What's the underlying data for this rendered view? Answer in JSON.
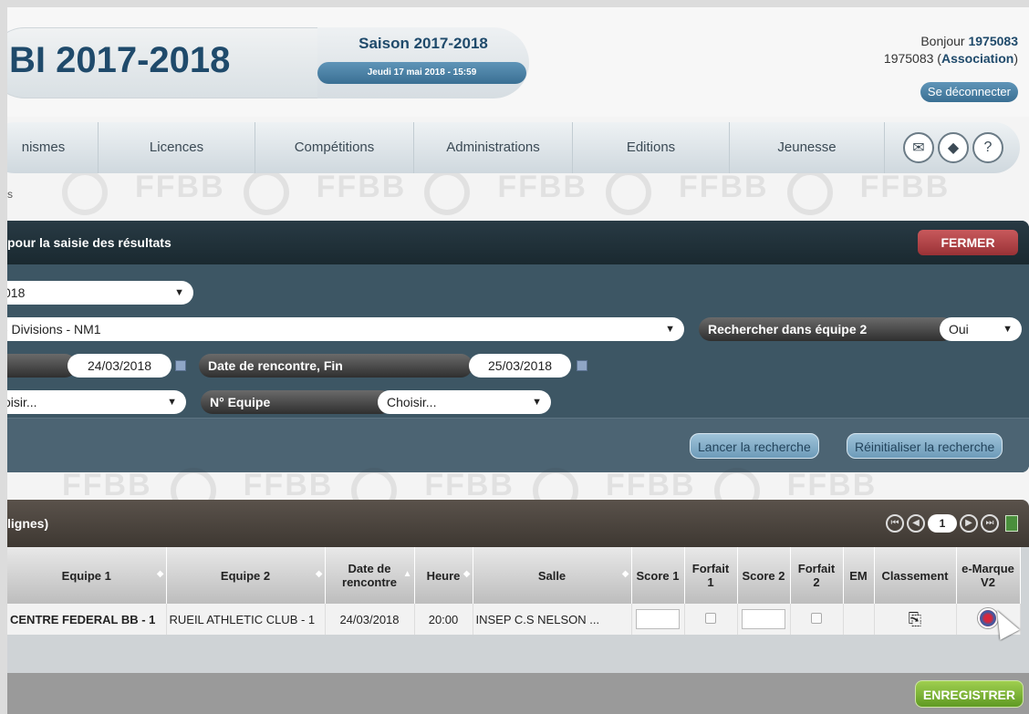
{
  "header": {
    "app_title": "BI 2017-2018",
    "season": "Saison 2017-2018",
    "datetime": "Jeudi 17 mai 2018 - 15:59",
    "greeting_prefix": "Bonjour ",
    "greeting_user": "1975083",
    "account_line_prefix": "1975083 (",
    "account_role": "Association",
    "account_line_suffix": ")",
    "logout_label": "Se déconnecter"
  },
  "nav": {
    "items": [
      "nismes",
      "Licences",
      "Compétitions",
      "Administrations",
      "Editions",
      "Jeunesse"
    ],
    "icons": [
      "mail-icon",
      "book-icon",
      "help-icon"
    ],
    "help_glyph": "?"
  },
  "breadcrumb": "s",
  "search": {
    "title": "pour la saisie des résultats",
    "close_label": "FERMER",
    "season_value": "018",
    "division_value": "- Divisions - NM1",
    "search_team2_label": "Rechercher dans équipe 2",
    "search_team2_value": "Oui",
    "date_start_value": "24/03/2018",
    "date_end_label": "Date de rencontre, Fin",
    "date_end_value": "25/03/2018",
    "choose1_value": "oisir...",
    "team_no_label": "N° Equipe",
    "team_no_value": "Choisir...",
    "run_label": "Lancer la recherche",
    "reset_label": "Réinitialiser la recherche"
  },
  "results": {
    "title": "lignes)",
    "page": "1",
    "columns": [
      "Equipe 1",
      "Equipe 2",
      "Date de rencontre",
      "Heure",
      "Salle",
      "Score 1",
      "Forfait 1",
      "Score 2",
      "Forfait 2",
      "EM",
      "Classement",
      "e-Marque V2"
    ],
    "rows": [
      {
        "equipe1": "CENTRE FEDERAL BB - 1",
        "equipe2": "RUEIL ATHLETIC CLUB - 1",
        "date": "24/03/2018",
        "heure": "20:00",
        "salle": "INSEP C.S NELSON ..."
      }
    ],
    "save_label": "ENREGISTRER"
  }
}
